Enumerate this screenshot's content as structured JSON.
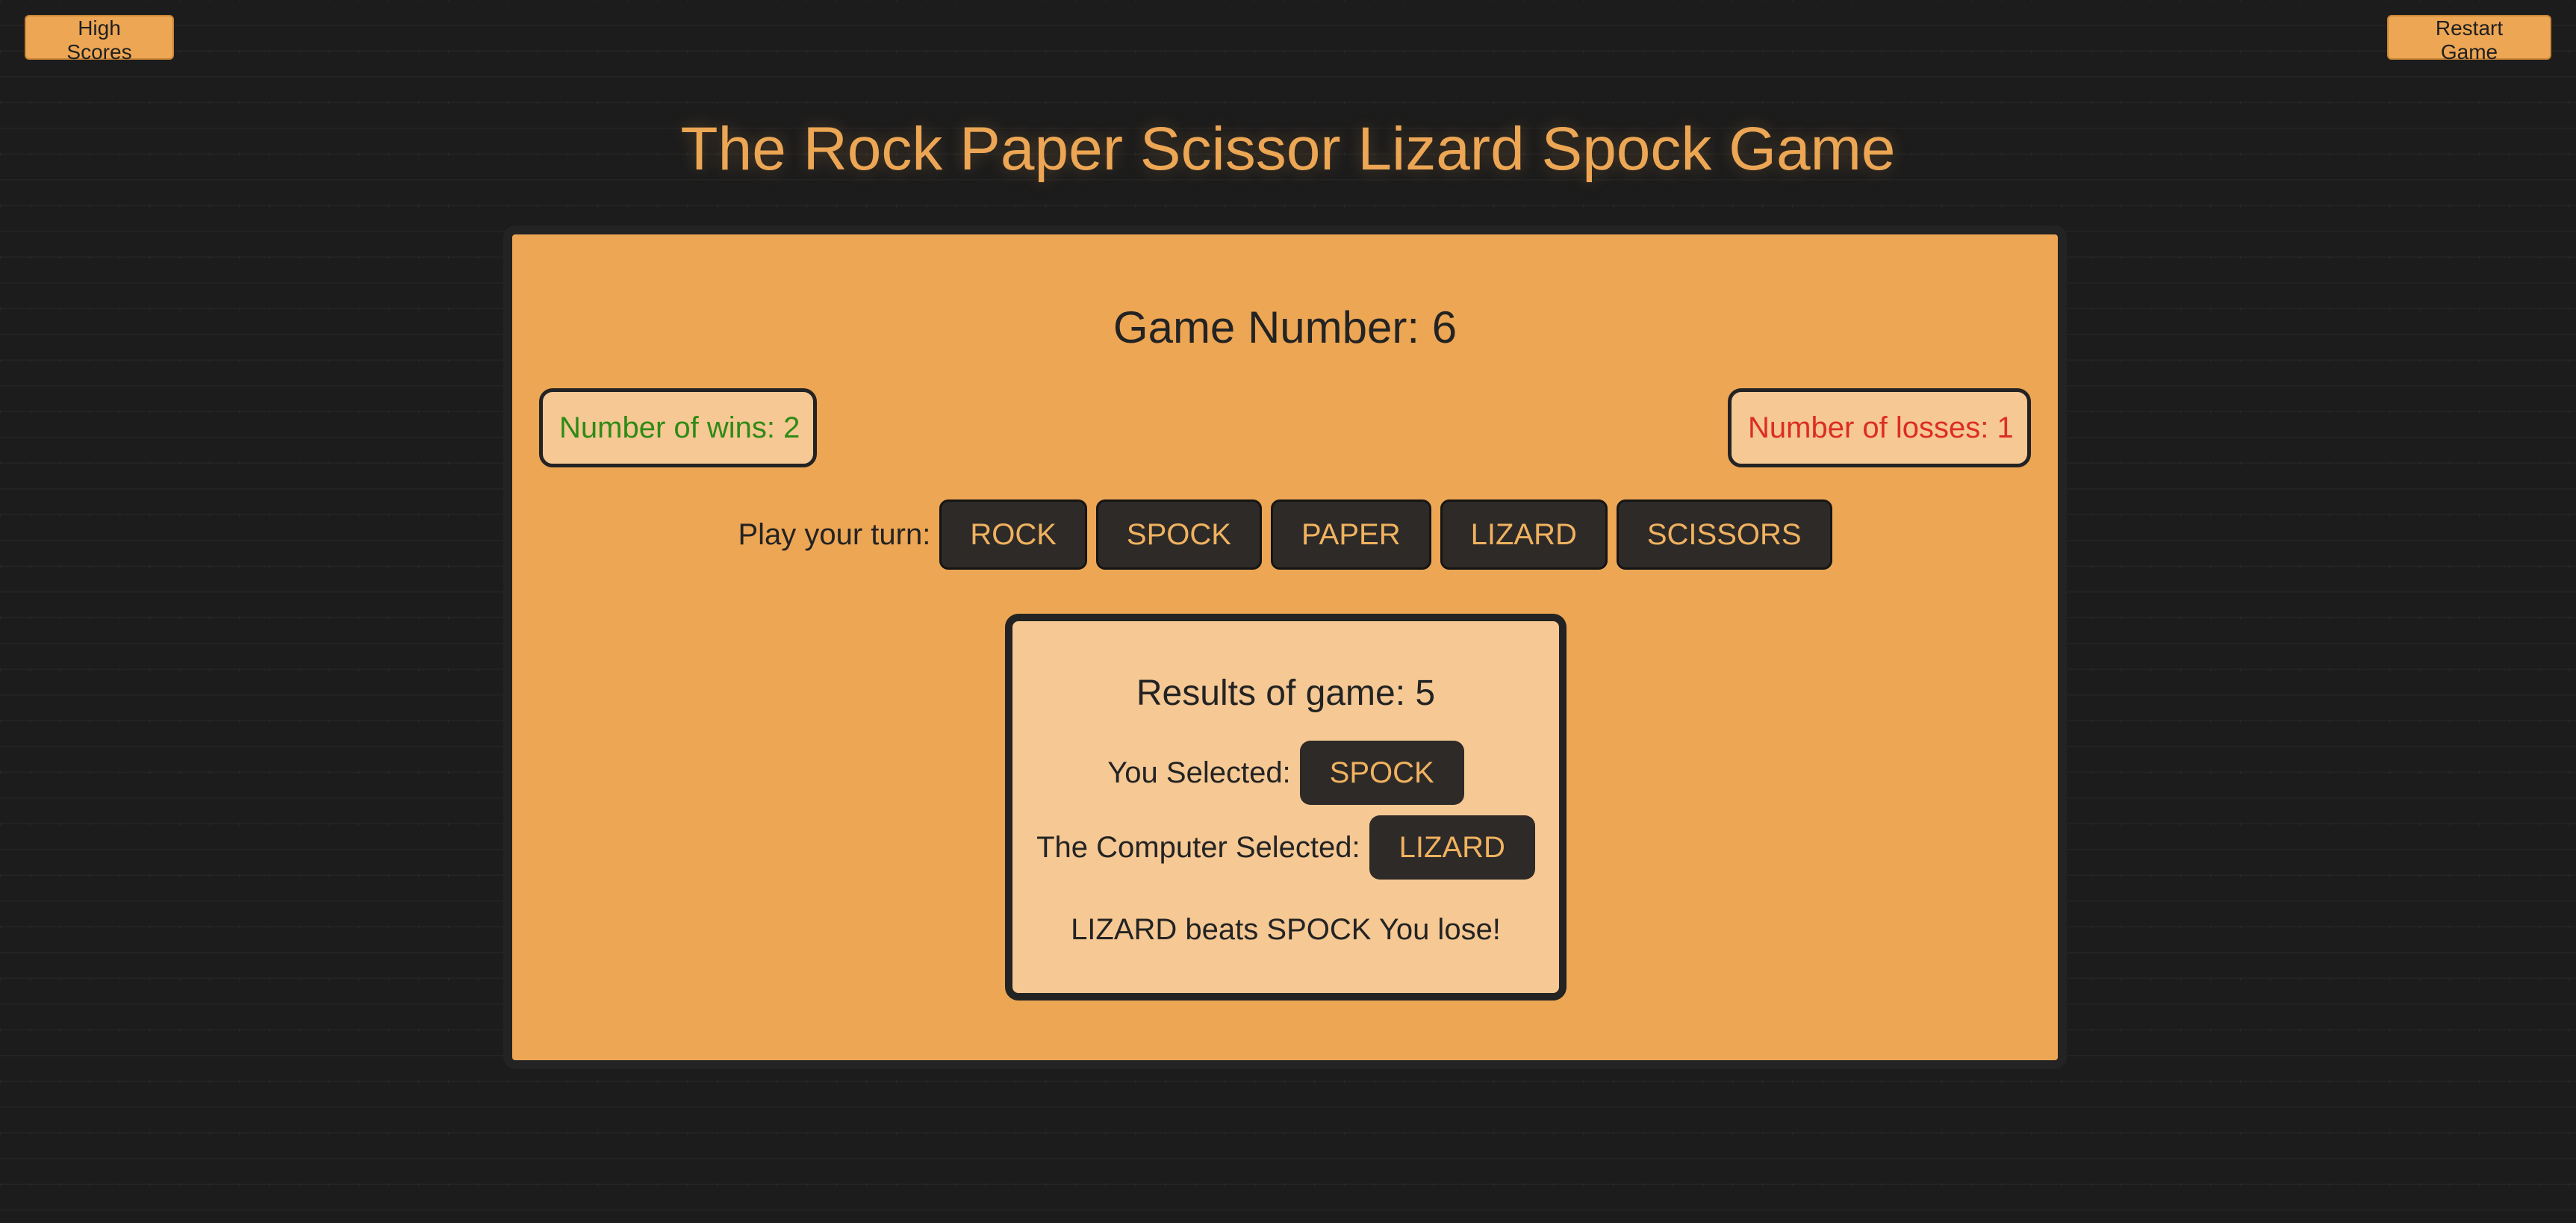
{
  "header": {
    "high_scores_label": "High Scores",
    "restart_label": "Restart Game",
    "title": "The Rock Paper Scissor Lizard Spock Game"
  },
  "board": {
    "game_number": "Game Number: 6",
    "wins_text": "Number of wins: 2",
    "losses_text": "Number of losses: 1",
    "turn_label": "Play your turn:",
    "choices": [
      "ROCK",
      "SPOCK",
      "PAPER",
      "LIZARD",
      "SCISSORS"
    ]
  },
  "results": {
    "title": "Results of game: 5",
    "you_label": "You Selected:",
    "you_value": "SPOCK",
    "computer_label": "The Computer Selected:",
    "computer_value": "LIZARD",
    "verdict": "LIZARD beats SPOCK You lose!"
  },
  "colors": {
    "accent": "#eca654",
    "dark": "#232323",
    "button_text": "#f0b25f",
    "win": "#2f8a16",
    "loss": "#dc2d24",
    "panel_light": "#f5c894"
  }
}
